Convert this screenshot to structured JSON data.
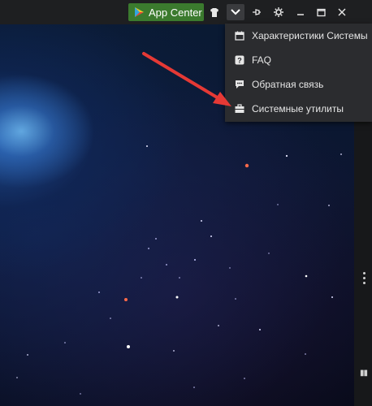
{
  "topbar": {
    "app_center_label": "App Center"
  },
  "menu": {
    "items": [
      {
        "label": "Характеристики Системы",
        "icon": "calendar-icon"
      },
      {
        "label": "FAQ",
        "icon": "question-icon"
      },
      {
        "label": "Обратная связь",
        "icon": "chat-icon"
      },
      {
        "label": "Системные утилиты",
        "icon": "toolbox-icon"
      }
    ]
  },
  "colors": {
    "app_center_bg": "#3b7a2e",
    "arrow": "#e53935",
    "menu_bg": "#2b2c2f",
    "topbar_bg": "#1e1f21"
  }
}
